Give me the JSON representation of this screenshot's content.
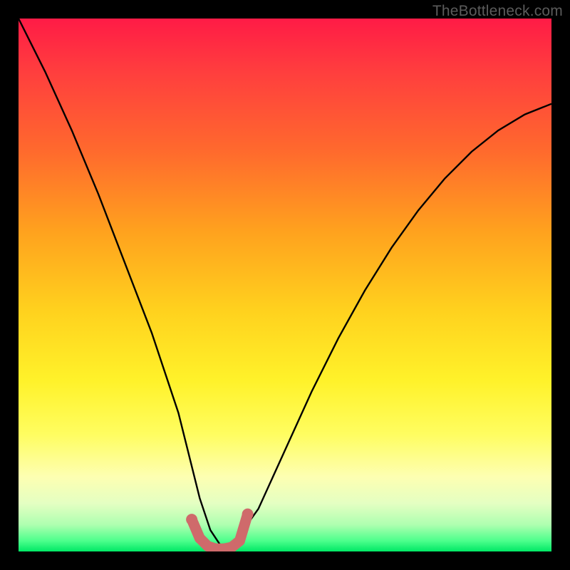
{
  "watermark": "TheBottleneck.com",
  "colors": {
    "frame": "#000000",
    "curve": "#000000",
    "marker": "#cf6a6b",
    "gradient_top": "#ff1b46",
    "gradient_bottom": "#00e865"
  },
  "chart_data": {
    "type": "line",
    "title": "",
    "xlabel": "",
    "ylabel": "",
    "xlim": [
      0,
      100
    ],
    "ylim": [
      0,
      100
    ],
    "series": [
      {
        "name": "bottleneck-curve",
        "x": [
          0,
          5,
          10,
          15,
          20,
          25,
          30,
          32,
          34,
          36,
          38,
          40,
          45,
          50,
          55,
          60,
          65,
          70,
          75,
          80,
          85,
          90,
          95,
          100
        ],
        "values": [
          100,
          90,
          79,
          67,
          54,
          41,
          26,
          18,
          10,
          4,
          1,
          1,
          8,
          19,
          30,
          40,
          49,
          57,
          64,
          70,
          75,
          79,
          82,
          84
        ]
      }
    ],
    "markers": {
      "name": "bottom-indicator",
      "x": [
        32.5,
        34,
        35.5,
        37,
        38.5,
        40,
        41.5,
        43
      ],
      "values": [
        6.0,
        2.5,
        1.0,
        0.5,
        0.5,
        0.8,
        2.0,
        7.0
      ]
    }
  }
}
